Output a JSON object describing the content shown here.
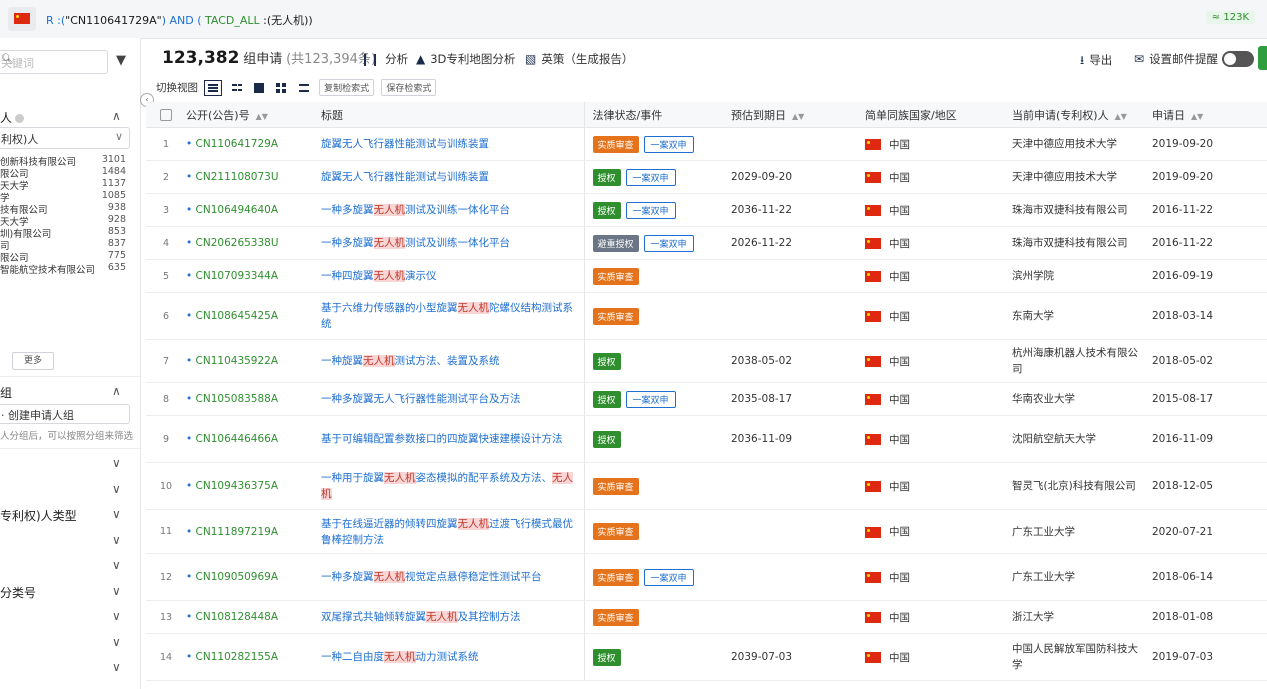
{
  "query": {
    "prefix": "R :(",
    "number": "\"CN110641729A\"",
    "mid": ") AND (",
    "field": "TACD_ALL",
    "suffix": ":(无人机))",
    "count_badge": "≈ 123K"
  },
  "sidebar": {
    "search_placeholder": "关键词",
    "section1_title": "人",
    "section1_select": "利权)人",
    "applicants": [
      {
        "name": "创新科技有限公司",
        "count": "3101"
      },
      {
        "name": "限公司",
        "count": "1484"
      },
      {
        "name": "天大学",
        "count": "1137"
      },
      {
        "name": "学",
        "count": "1085"
      },
      {
        "name": "技有限公司",
        "count": "938"
      },
      {
        "name": "天大学",
        "count": "928"
      },
      {
        "name": "圳)有限公司",
        "count": "853"
      },
      {
        "name": "司",
        "count": "837"
      },
      {
        "name": "限公司",
        "count": "775"
      },
      {
        "name": "智能航空技术有限公司",
        "count": "635"
      }
    ],
    "more_label": "更多",
    "group_title": "组",
    "group_input": "· 创建申请人组",
    "group_hint": "人分组后，可以按照分组来筛选",
    "collapsed_sections": [
      "",
      "",
      "专利权)人类型",
      "",
      "",
      "分类号",
      "",
      "",
      ""
    ]
  },
  "header": {
    "count": "123,382",
    "unit": "组申请",
    "sub": "(共123,394条)",
    "analysis": "分析",
    "map3d": "3D专利地图分析",
    "insight": "英策（生成报告）",
    "export": "导出",
    "email_alert": "设置邮件提醒"
  },
  "viewbar": {
    "switch_label": "切换视图",
    "copy_query": "复制检索式",
    "save_query": "保存检索式"
  },
  "table": {
    "columns": {
      "pub_no": "公开(公告)号",
      "title": "标题",
      "legal": "法律状态/事件",
      "expiry": "预估到期日",
      "country": "简单同族国家/地区",
      "applicant": "当前申请(专利权)人",
      "filed": "申请日"
    },
    "rows": [
      {
        "n": "1",
        "pn": "CN110641729A",
        "title": [
          "旋翼无人飞行器性能测试与训练装置"
        ],
        "status": "实质审查",
        "color": "orange",
        "tag": "一案双申",
        "expiry": "",
        "country": "中国",
        "applicant": "天津中德应用技术大学",
        "date": "2019-09-20"
      },
      {
        "n": "2",
        "pn": "CN211108073U",
        "title": [
          "旋翼无人飞行器性能测试与训练装置"
        ],
        "status": "授权",
        "color": "green",
        "tag": "一案双申",
        "expiry": "2029-09-20",
        "country": "中国",
        "applicant": "天津中德应用技术大学",
        "date": "2019-09-20"
      },
      {
        "n": "3",
        "pn": "CN106494640A",
        "title": [
          "一种多旋翼",
          "无人机",
          "测试及训练一体化平台"
        ],
        "status": "授权",
        "color": "green",
        "tag": "一案双申",
        "expiry": "2036-11-22",
        "country": "中国",
        "applicant": "珠海市双捷科技有限公司",
        "date": "2016-11-22"
      },
      {
        "n": "4",
        "pn": "CN206265338U",
        "title": [
          "一种多旋翼",
          "无人机",
          "测试及训练一体化平台"
        ],
        "status": "避重授权",
        "color": "gray",
        "tag": "一案双申",
        "expiry": "2026-11-22",
        "country": "中国",
        "applicant": "珠海市双捷科技有限公司",
        "date": "2016-11-22"
      },
      {
        "n": "5",
        "pn": "CN107093344A",
        "title": [
          "一种四旋翼",
          "无人机",
          "演示仪"
        ],
        "status": "实质审查",
        "color": "orange",
        "tag": "",
        "expiry": "",
        "country": "中国",
        "applicant": "滨州学院",
        "date": "2016-09-19"
      },
      {
        "n": "6",
        "pn": "CN108645425A",
        "title": [
          "基于六维力传感器的小型旋翼",
          "无人机",
          "陀螺仪结构测试系统"
        ],
        "status": "实质审查",
        "color": "orange",
        "tag": "",
        "expiry": "",
        "country": "中国",
        "applicant": "东南大学",
        "date": "2018-03-14"
      },
      {
        "n": "7",
        "pn": "CN110435922A",
        "title": [
          "一种旋翼",
          "无人机",
          "测试方法、装置及系统"
        ],
        "status": "授权",
        "color": "green",
        "tag": "",
        "expiry": "2038-05-02",
        "country": "中国",
        "applicant": "杭州海康机器人技术有限公司",
        "date": "2018-05-02"
      },
      {
        "n": "8",
        "pn": "CN105083588A",
        "title": [
          "一种多旋翼无人飞行器性能测试平台及方法"
        ],
        "status": "授权",
        "color": "green",
        "tag": "一案双申",
        "expiry": "2035-08-17",
        "country": "中国",
        "applicant": "华南农业大学",
        "date": "2015-08-17"
      },
      {
        "n": "9",
        "pn": "CN106446466A",
        "title": [
          "基于可编辑配置参数接口的四旋翼快速建模设计方法"
        ],
        "status": "授权",
        "color": "green",
        "tag": "",
        "expiry": "2036-11-09",
        "country": "中国",
        "applicant": "沈阳航空航天大学",
        "date": "2016-11-09"
      },
      {
        "n": "10",
        "pn": "CN109436375A",
        "title": [
          "一种用于旋翼",
          "无人机",
          "姿态模拟的配平系统及方法、",
          "无人机"
        ],
        "status": "实质审查",
        "color": "orange",
        "tag": "",
        "expiry": "",
        "country": "中国",
        "applicant": "智灵飞(北京)科技有限公司",
        "date": "2018-12-05"
      },
      {
        "n": "11",
        "pn": "CN111897219A",
        "title": [
          "基于在线逼近器的倾转四旋翼",
          "无人机",
          "过渡飞行模式最优鲁棒控制方法"
        ],
        "status": "实质审查",
        "color": "orange",
        "tag": "",
        "expiry": "",
        "country": "中国",
        "applicant": "广东工业大学",
        "date": "2020-07-21"
      },
      {
        "n": "12",
        "pn": "CN109050969A",
        "title": [
          "一种多旋翼",
          "无人机",
          "视觉定点悬停稳定性测试平台"
        ],
        "status": "实质审查",
        "color": "orange",
        "tag": "一案双申",
        "expiry": "",
        "country": "中国",
        "applicant": "广东工业大学",
        "date": "2018-06-14"
      },
      {
        "n": "13",
        "pn": "CN108128448A",
        "title": [
          "双尾撑式共轴倾转旋翼",
          "无人机",
          "及其控制方法"
        ],
        "status": "实质审查",
        "color": "orange",
        "tag": "",
        "expiry": "",
        "country": "中国",
        "applicant": "浙江大学",
        "date": "2018-01-08"
      },
      {
        "n": "14",
        "pn": "CN110282155A",
        "title": [
          "一种二自由度",
          "无人机",
          "动力测试系统"
        ],
        "status": "授权",
        "color": "green",
        "tag": "",
        "expiry": "2039-07-03",
        "country": "中国",
        "applicant": "中国人民解放军国防科技大学",
        "date": "2019-07-03"
      }
    ]
  }
}
